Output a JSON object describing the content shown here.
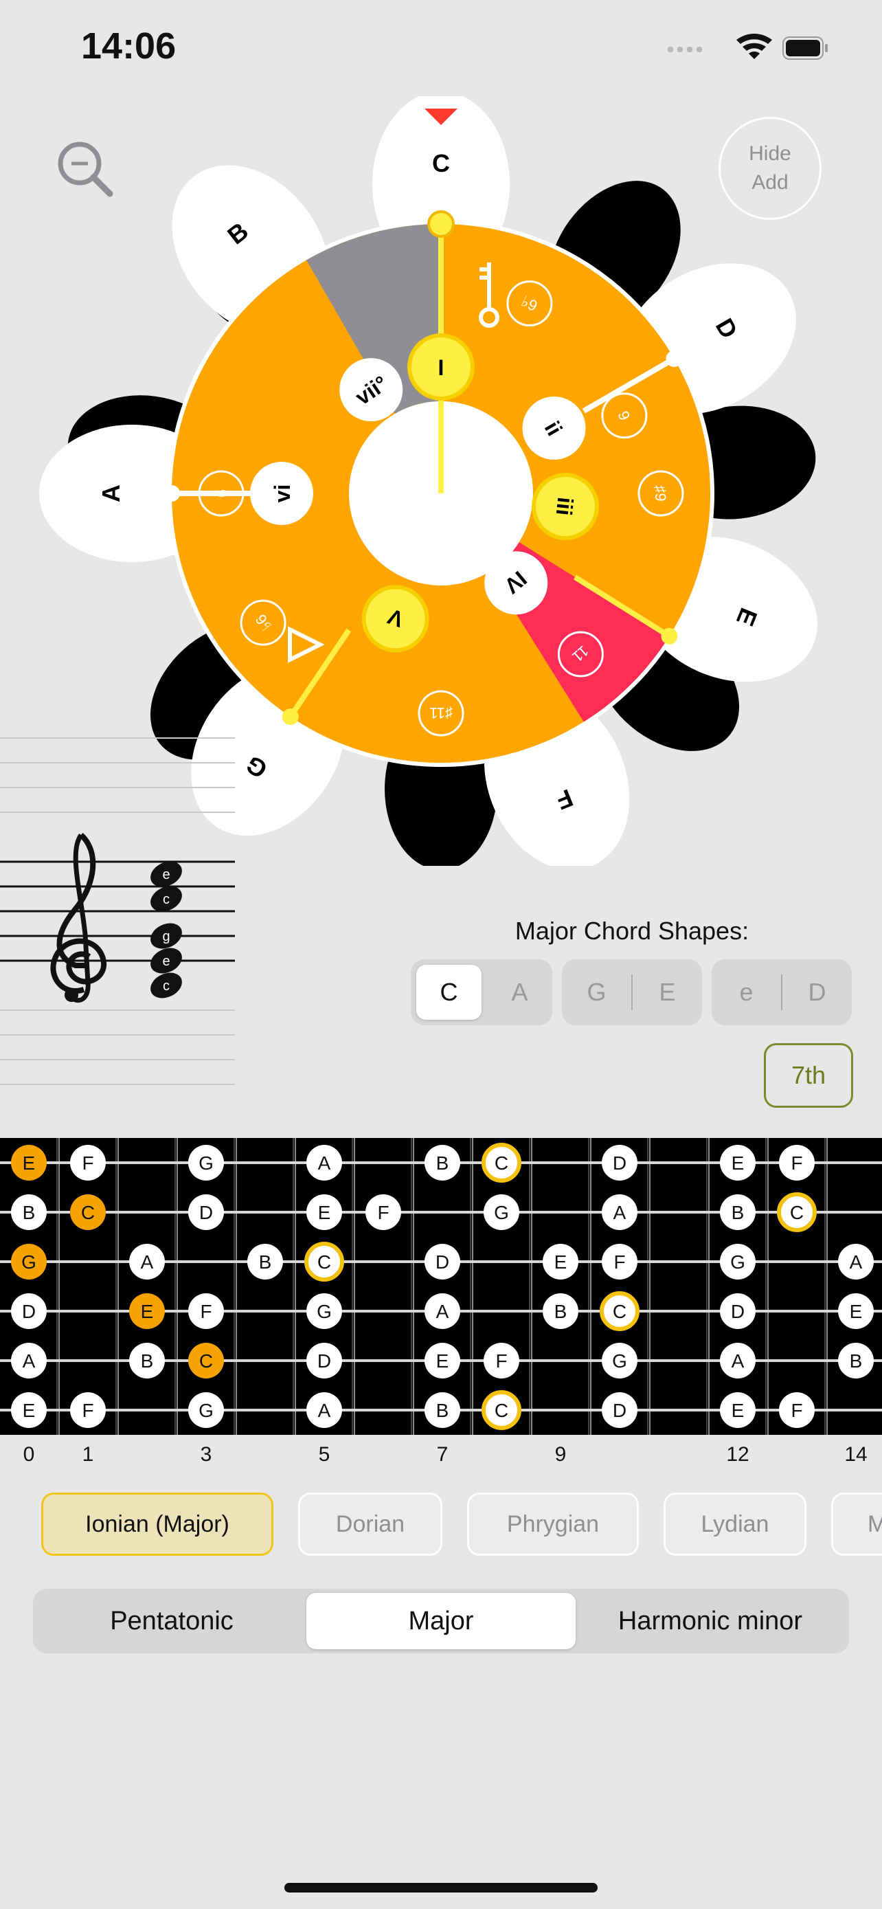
{
  "status": {
    "time": "14:06"
  },
  "add_panel": {
    "line1": "Hide",
    "line2": "Add"
  },
  "circle": {
    "notes": [
      "C",
      "D",
      "E",
      "F",
      "G",
      "A",
      "B"
    ],
    "degrees": [
      "I",
      "ii",
      "iii",
      "IV",
      "V",
      "vi",
      "vii°"
    ],
    "extensions": [
      "♭9",
      "9",
      "♯9",
      "11",
      "♯11",
      "♭6",
      "6"
    ],
    "colors": {
      "main": "#ffa500",
      "accent": "#ff2d55",
      "gray": "#8e8e93",
      "highlight": "#ffee44",
      "pointer": "#ff3b30"
    }
  },
  "staff": {
    "notes": [
      "e",
      "c",
      "g",
      "e",
      "c"
    ]
  },
  "chord_shapes": {
    "title": "Major Chord Shapes:",
    "group1": [
      "C",
      "A"
    ],
    "group2": [
      "G",
      "E"
    ],
    "group3": [
      "e",
      "D"
    ],
    "selected": "C",
    "seventh_label": "7th"
  },
  "fretboard": {
    "fret_numbers": [
      "0",
      "1",
      "3",
      "5",
      "7",
      "9",
      "12",
      "14"
    ],
    "strings": [
      [
        "E",
        "F",
        "",
        "G",
        "",
        "A",
        "",
        "B",
        "C",
        "",
        "D",
        "",
        "E",
        "F",
        ""
      ],
      [
        "B",
        "C",
        "",
        "D",
        "",
        "E",
        "F",
        "",
        "G",
        "",
        "A",
        "",
        "B",
        "C",
        ""
      ],
      [
        "G",
        "",
        "A",
        "",
        "B",
        "C",
        "",
        "D",
        "",
        "E",
        "F",
        "",
        "G",
        "",
        "A"
      ],
      [
        "D",
        "",
        "E",
        "F",
        "",
        "G",
        "",
        "A",
        "",
        "B",
        "C",
        "",
        "D",
        "",
        "E"
      ],
      [
        "A",
        "",
        "B",
        "C",
        "",
        "D",
        "",
        "E",
        "F",
        "",
        "G",
        "",
        "A",
        "",
        "B"
      ],
      [
        "E",
        "F",
        "",
        "G",
        "",
        "A",
        "",
        "B",
        "C",
        "",
        "D",
        "",
        "E",
        "F",
        ""
      ]
    ]
  },
  "modes": [
    "Ionian (Major)",
    "Dorian",
    "Phrygian",
    "Lydian",
    "M"
  ],
  "scales": {
    "items": [
      "Pentatonic",
      "Major",
      "Harmonic minor"
    ],
    "selected": "Major"
  }
}
